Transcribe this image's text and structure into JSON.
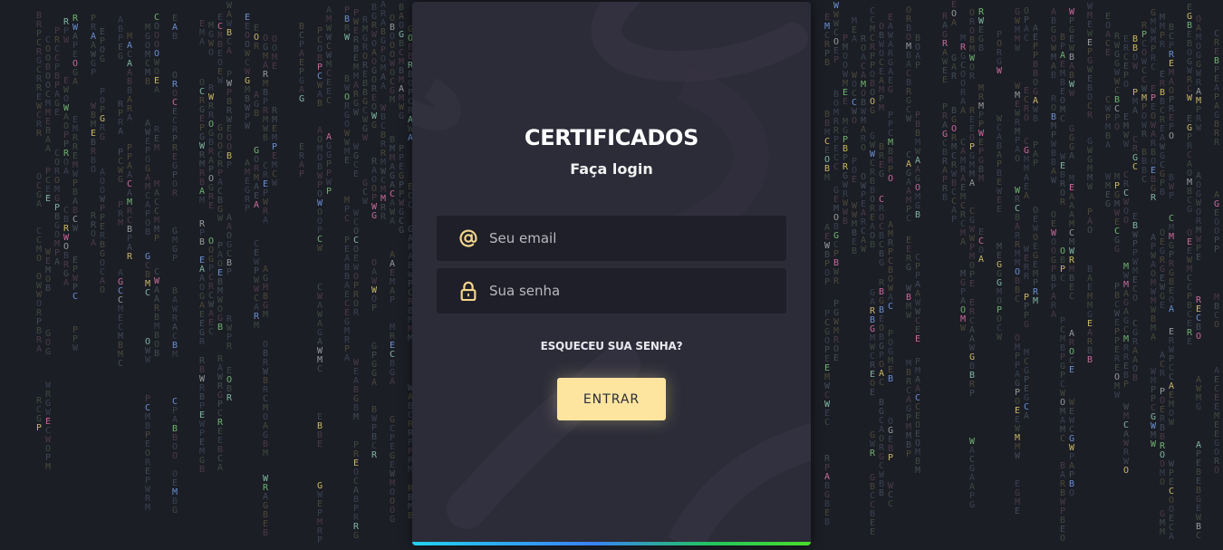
{
  "login": {
    "title": "CERTIFICADOS",
    "subtitle": "Faça login",
    "email_placeholder": "Seu email",
    "password_placeholder": "Sua senha",
    "forgot_label": "ESQUECEU SUA SENHA?",
    "submit_label": "ENTRAR"
  },
  "icons": {
    "email": "at-sign-icon",
    "password": "lock-icon"
  },
  "colors": {
    "background": "#1c1e26",
    "card": "#2b2c38",
    "field": "#1f1f29",
    "accent": "#fde59f",
    "icon": "#f3d58d"
  },
  "matrix_letters": "ABCEGMOPRW"
}
